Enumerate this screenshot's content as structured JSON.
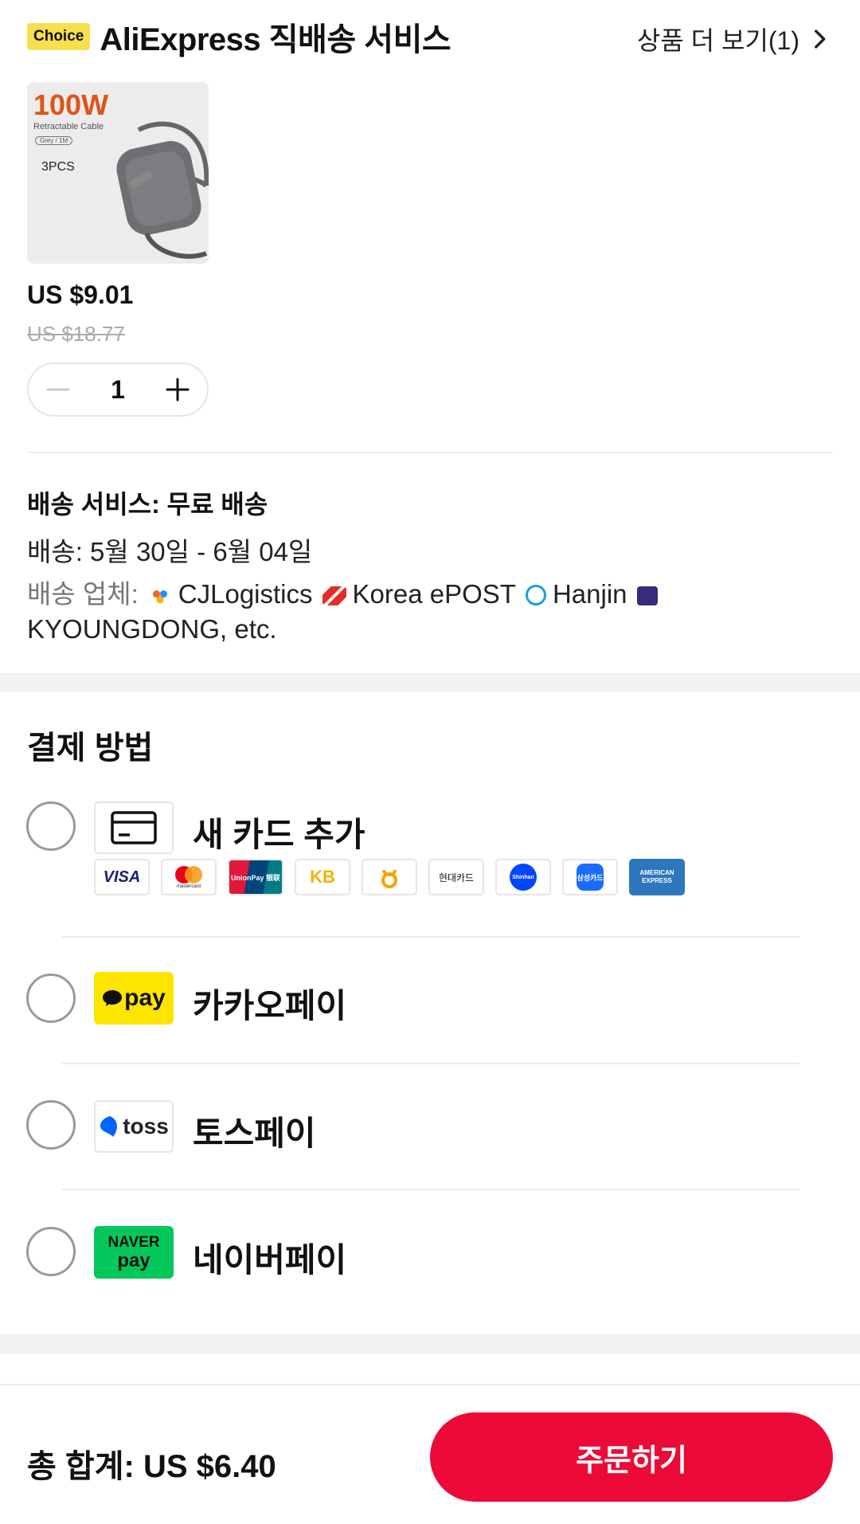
{
  "header": {
    "badge": "Choice",
    "title": "AliExpress 직배송 서비스",
    "more": "상품 더 보기(1)"
  },
  "product": {
    "image": {
      "title": "100W",
      "subtitle": "Retractable Cable",
      "chip": "Grey / 1M",
      "pcs": "3PCS"
    },
    "price": "US $9.01",
    "old_price": "US $18.77",
    "quantity": "1"
  },
  "shipping": {
    "service": "배송 서비스:  무료 배송",
    "date": "배송: 5월 30일 - 6월 04일",
    "carriers_label": "배송 업체:",
    "carriers": [
      "CJLogistics",
      "Korea ePOST",
      "Hanjin",
      "KYOUNGDONG, etc."
    ]
  },
  "payment": {
    "title": "결제 방법",
    "methods": [
      {
        "label": "새 카드 추가",
        "icon": "credit-card-icon"
      },
      {
        "label": "카카오페이",
        "icon_text": "pay"
      },
      {
        "label": "토스페이",
        "icon_text": "toss"
      },
      {
        "label": "네이버페이",
        "icon_text_top": "NAVER",
        "icon_text_bottom": "pay"
      }
    ],
    "card_logos": [
      "VISA",
      "mastercard",
      "UnionPay 银联",
      "KB",
      "NH",
      "현대카드",
      "Shinhan",
      "삼성카드",
      "AMERICAN EXPRESS"
    ]
  },
  "footer": {
    "total": "총 합계:  US $6.40",
    "order_button": "주문하기"
  },
  "colors": {
    "accent": "#ec0a37",
    "choice_badge": "#f7df4f",
    "kakao": "#fee500",
    "naver": "#03c75a",
    "toss": "#0064ff"
  }
}
